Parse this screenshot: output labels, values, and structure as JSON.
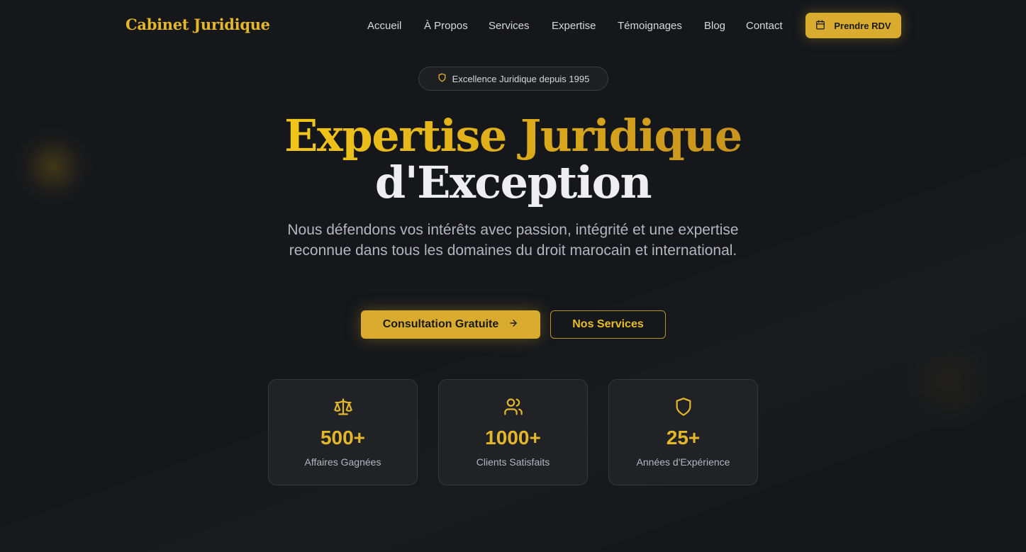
{
  "nav": {
    "logo": "Cabinet Juridique",
    "links": [
      "Accueil",
      "À Propos",
      "Services",
      "Expertise",
      "Témoignages",
      "Blog",
      "Contact"
    ],
    "cta_label": "Prendre RDV",
    "cta_icon": "calendar-icon"
  },
  "hero": {
    "badge_icon": "shield-icon",
    "badge": "Excellence Juridique depuis 1995",
    "title_line1": "Expertise Juridique",
    "title_line2": "d'Exception",
    "subtitle": "Nous défendons vos intérêts avec passion, intégrité et une expertise reconnue dans tous les domaines du droit marocain et international.",
    "primary_button": "Consultation Gratuite",
    "primary_button_icon": "arrow-right-icon",
    "secondary_button": "Nos Services"
  },
  "stats": [
    {
      "icon": "scale-icon",
      "value": "500+",
      "label": "Affaires Gagnées"
    },
    {
      "icon": "users-icon",
      "value": "1000+",
      "label": "Clients Satisfaits"
    },
    {
      "icon": "shield-icon",
      "value": "25+",
      "label": "Années d'Expérience"
    }
  ],
  "colors": {
    "background": "#15171b",
    "accent": "#d9ac2f",
    "gold_text": "#e3b62c",
    "card_bg": "#202226"
  }
}
